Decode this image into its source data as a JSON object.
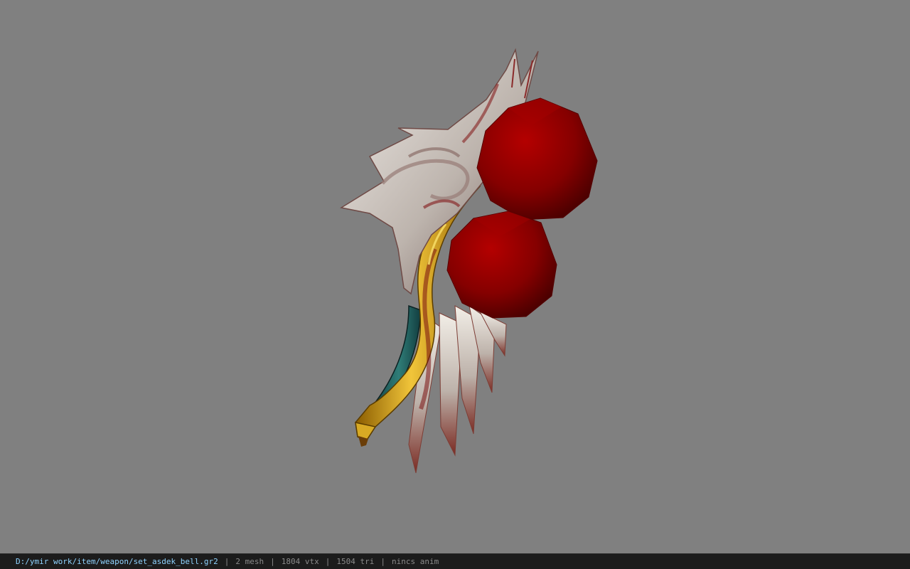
{
  "viewer": {
    "background_color": "#808080",
    "model_name": "set_asdek_bell"
  },
  "status_bar": {
    "file_path": "D:/ymir work/item/weapon/set_asdek_bell.gr2",
    "separator": "|",
    "mesh_count": "2 mesh",
    "vertex_count": "1804 vtx",
    "triangle_count": "1504 tri",
    "animation": "nincs anim"
  },
  "colors": {
    "status_path": "#8fd3ff",
    "status_text": "#8a8a8a",
    "status_bg": "#1c1c1c",
    "bell_red": "#8b0000",
    "gold": "#c99a12",
    "silver": "#d8d2cc",
    "teal": "#1f5c5a"
  }
}
